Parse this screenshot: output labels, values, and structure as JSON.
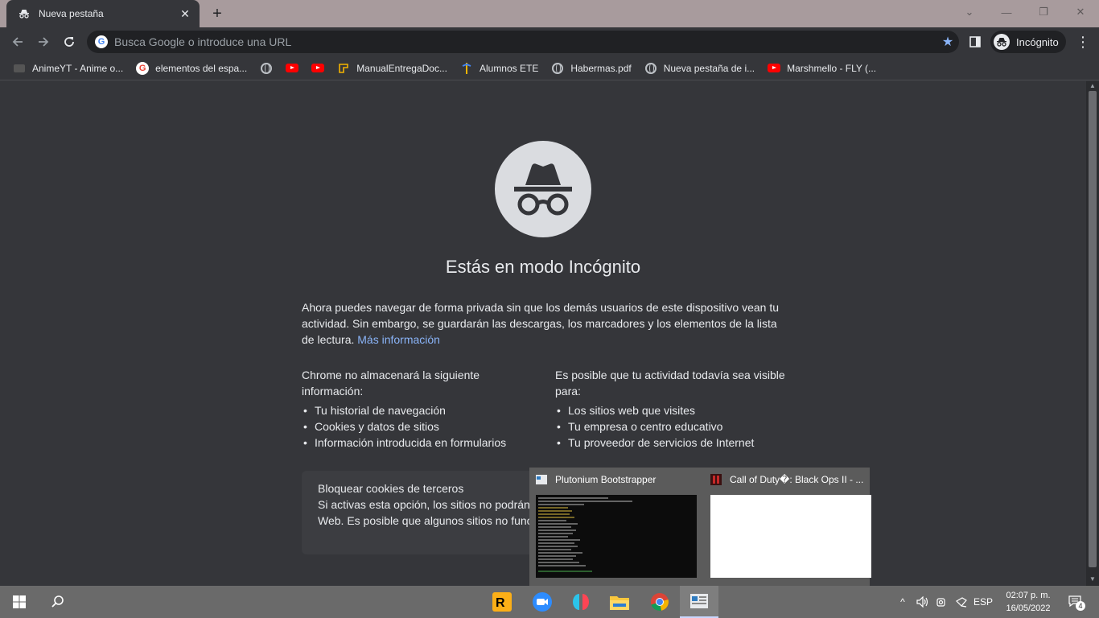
{
  "tab": {
    "title": "Nueva pestaña",
    "icon": "incognito-icon"
  },
  "toolbar": {
    "omnibox_placeholder": "Busca Google o introduce una URL",
    "profile_label": "Incógnito"
  },
  "bookmarks": [
    {
      "label": "AnimeYT - Anime o...",
      "icon": "anime-site-icon"
    },
    {
      "label": "elementos del espa...",
      "icon": "google-icon"
    },
    {
      "label": "",
      "icon": "globe-icon"
    },
    {
      "label": "",
      "icon": "youtube-icon"
    },
    {
      "label": "",
      "icon": "youtube-icon"
    },
    {
      "label": "ManualEntregaDoc...",
      "icon": "document-icon"
    },
    {
      "label": "Alumnos ETE",
      "icon": "school-icon"
    },
    {
      "label": "Habermas.pdf",
      "icon": "globe-icon"
    },
    {
      "label": "Nueva pestaña de i...",
      "icon": "globe-icon"
    },
    {
      "label": "Marshmello - FLY (...",
      "icon": "youtube-icon"
    }
  ],
  "page": {
    "heading": "Estás en modo Incógnito",
    "intro": "Ahora puedes navegar de forma privada sin que los demás usuarios de este dispositivo vean tu actividad. Sin embargo, se guardarán las descargas, los marcadores y los elementos de la lista de lectura.",
    "learn_more": "Más información",
    "left_col": {
      "head_pre": "Chrome ",
      "head_bold": "no almacenará",
      "head_post": " la siguiente información:",
      "items": [
        "Tu historial de navegación",
        "Cookies y datos de sitios",
        "Información introducida en formularios"
      ]
    },
    "right_col": {
      "head_pre": "Es posible que tu actividad ",
      "head_bold": "todavía sea visible",
      "head_post": " para:",
      "items": [
        "Los sitios web que visites",
        "Tu empresa o centro educativo",
        "Tu proveedor de servicios de Internet"
      ]
    },
    "cookies": {
      "title": "Bloquear cookies de terceros",
      "text": "Si activas esta opción, los sitios no podrán hacer un seguimiento de tu actividad en la Web. Es posible que algunos sitios no funcionen correctamente."
    }
  },
  "preview": [
    {
      "title": "Plutonium Bootstrapper"
    },
    {
      "title": "Call of Duty�: Black Ops II - ..."
    }
  ],
  "taskbar": {
    "language": "ESP",
    "time": "02:07 p. m.",
    "date": "16/05/2022",
    "notifications": "4"
  }
}
